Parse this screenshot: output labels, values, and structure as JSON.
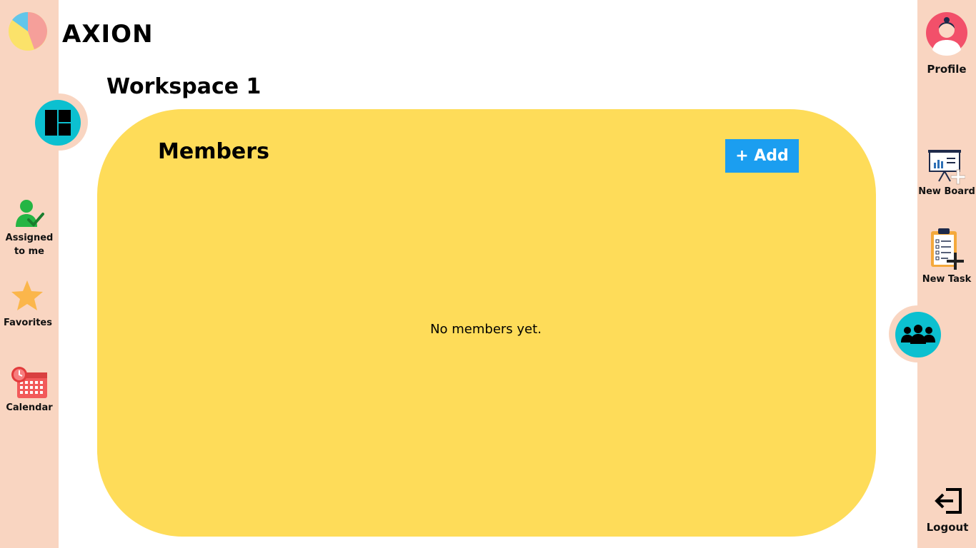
{
  "brand": {
    "name": "AXION"
  },
  "workspace": {
    "title": "Workspace 1"
  },
  "left_nav": {
    "assigned_line1": "Assigned",
    "assigned_line2": "to me",
    "favorites": "Favorites",
    "calendar": "Calendar"
  },
  "right_nav": {
    "profile": "Profile",
    "new_board": "New Board",
    "new_task": "New Task",
    "logout": "Logout"
  },
  "members": {
    "title": "Members",
    "add_label": "+ Add",
    "empty_text": "No members yet."
  },
  "icons": {
    "boards": "boards-grid-icon",
    "members": "group-icon",
    "assigned": "user-check-icon",
    "favorites": "star-icon",
    "calendar": "calendar-icon",
    "new_board": "presentation-board-plus-icon",
    "new_task": "clipboard-plus-icon",
    "logout": "logout-arrow-icon",
    "profile": "avatar-icon"
  },
  "colors": {
    "rail": "#f9d5c1",
    "card": "#fedc59",
    "accent_teal": "#0cc0d0",
    "add_button": "#1b9ef0"
  }
}
